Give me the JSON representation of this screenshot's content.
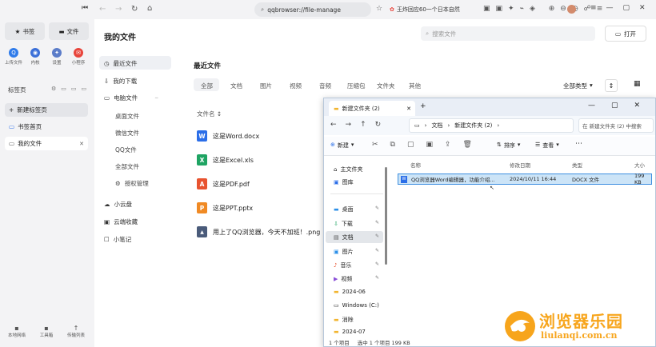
{
  "sidebar": {
    "quick": [
      {
        "label": "书签"
      },
      {
        "label": "文件"
      }
    ],
    "tools": [
      {
        "label": "上传文件",
        "color": "#2f7bea",
        "glyph": "Q"
      },
      {
        "label": "内核",
        "color": "#3b6fd8",
        "glyph": "◉"
      },
      {
        "label": "设置",
        "color": "#5b7cc9",
        "glyph": "✦"
      },
      {
        "label": "小程序",
        "color": "#e8453c",
        "glyph": "✉"
      }
    ],
    "section_label": "标签页",
    "new_tab": "新建标签页",
    "tabs": [
      {
        "label": "书签首页"
      },
      {
        "label": "我的文件"
      }
    ],
    "bottom": [
      {
        "label": "本地网络"
      },
      {
        "label": "工具箱"
      },
      {
        "label": "传输列表"
      }
    ]
  },
  "topbar": {
    "url": "qqbrowser://file-manage",
    "news": "王炸回应60一个日本自然"
  },
  "main": {
    "page_title": "我的文件",
    "search_placeholder": "搜索文件",
    "open_button": "打开",
    "nav": [
      {
        "label": "最近文件"
      },
      {
        "label": "我的下载"
      },
      {
        "label": "电脑文件"
      },
      {
        "label": "桌面文件"
      },
      {
        "label": "微信文件"
      },
      {
        "label": "QQ文件"
      },
      {
        "label": "全部文件"
      },
      {
        "label": "授权管理"
      },
      {
        "label": "小云盘"
      },
      {
        "label": "云端收藏"
      },
      {
        "label": "小笔记"
      }
    ],
    "section_title": "最近文件",
    "filters": [
      "全部",
      "文档",
      "图片",
      "视频",
      "音频",
      "压缩包",
      "文件夹",
      "其他"
    ],
    "sort_label": "全部类型",
    "list_header": "文件名 ↕",
    "files": [
      {
        "name": "这是Word.docx",
        "type": "W",
        "color": "#2b6ee8"
      },
      {
        "name": "这是Excel.xls",
        "type": "X",
        "color": "#1fa463"
      },
      {
        "name": "这是PDF.pdf",
        "type": "A",
        "color": "#e8532f"
      },
      {
        "name": "这是PPT.pptx",
        "type": "P",
        "color": "#f08a24"
      },
      {
        "name": "用上了QQ浏览器，今天不加班！.png",
        "type": "img",
        "color": "#4a5b7a"
      }
    ]
  },
  "explorer": {
    "title": "新建文件夹 (2)",
    "breadcrumb": [
      "文档",
      "新建文件夹 (2)"
    ],
    "search_placeholder": "在 新建文件夹 (2) 中搜索",
    "cmd": {
      "new": "新建",
      "sort": "排序",
      "view": "查看"
    },
    "nav": [
      {
        "label": "主文件夹",
        "pin": false
      },
      {
        "label": "图库",
        "pin": false
      },
      {
        "label": "桌面",
        "pin": true
      },
      {
        "label": "下载",
        "pin": true
      },
      {
        "label": "文档",
        "pin": true
      },
      {
        "label": "图片",
        "pin": true
      },
      {
        "label": "音乐",
        "pin": true
      },
      {
        "label": "视频",
        "pin": true
      },
      {
        "label": "2024-06",
        "pin": false
      },
      {
        "label": "Windows (C:)",
        "pin": false
      },
      {
        "label": "消除",
        "pin": false
      },
      {
        "label": "2024-07",
        "pin": false
      }
    ],
    "columns": [
      "名称",
      "修改日期",
      "类型",
      "大小"
    ],
    "row": {
      "name": "QQ浏览器Word编辑器，功能介绍...",
      "date": "2024/10/11 16:44",
      "type": "DOCX 文件",
      "size": "199 KB"
    },
    "status": {
      "items": "1 个项目",
      "selected": "选中 1 个项目 199 KB"
    }
  },
  "watermark": {
    "title": "浏览器乐园",
    "url": "liulanqi.com.cn"
  }
}
